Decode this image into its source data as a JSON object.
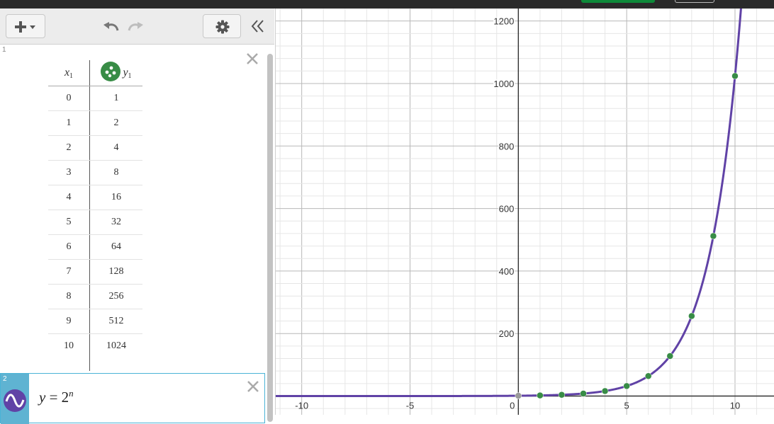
{
  "toolbar": {
    "add_icon": "plus-icon",
    "menu_icon": "caret-down-icon",
    "undo_icon": "undo-icon",
    "redo_icon": "redo-icon",
    "settings_icon": "gear-icon",
    "collapse_icon": "double-chevron-left-icon"
  },
  "expressions": [
    {
      "number": "1",
      "type": "table",
      "header_x": "x",
      "header_x_sub": "1",
      "header_y": "y",
      "header_y_sub": "1",
      "point_color": "#388c46",
      "rows": [
        [
          "0",
          "1"
        ],
        [
          "1",
          "2"
        ],
        [
          "2",
          "4"
        ],
        [
          "3",
          "8"
        ],
        [
          "4",
          "16"
        ],
        [
          "5",
          "32"
        ],
        [
          "6",
          "64"
        ],
        [
          "7",
          "128"
        ],
        [
          "8",
          "256"
        ],
        [
          "9",
          "512"
        ],
        [
          "10",
          "1024"
        ]
      ]
    },
    {
      "number": "2",
      "type": "expression",
      "lhs": "y",
      "equals": "=",
      "base": "2",
      "exponent": "n",
      "curve_color": "#6042a6"
    }
  ],
  "chart_data": {
    "type": "scatter",
    "xlim": [
      -11.2,
      11.8
    ],
    "ylim": [
      -60,
      1240
    ],
    "x_ticks": [
      -10,
      -5,
      0,
      5,
      10
    ],
    "y_ticks": [
      200,
      400,
      600,
      800,
      1000,
      1200
    ],
    "grid": true,
    "series": [
      {
        "type": "scatter",
        "color": "#388c46",
        "x": [
          0,
          1,
          2,
          3,
          4,
          5,
          6,
          7,
          8,
          9,
          10
        ],
        "y": [
          1,
          2,
          4,
          8,
          16,
          32,
          64,
          128,
          256,
          512,
          1024
        ]
      },
      {
        "type": "line",
        "color": "#6042a6",
        "function": "2^x"
      }
    ]
  }
}
